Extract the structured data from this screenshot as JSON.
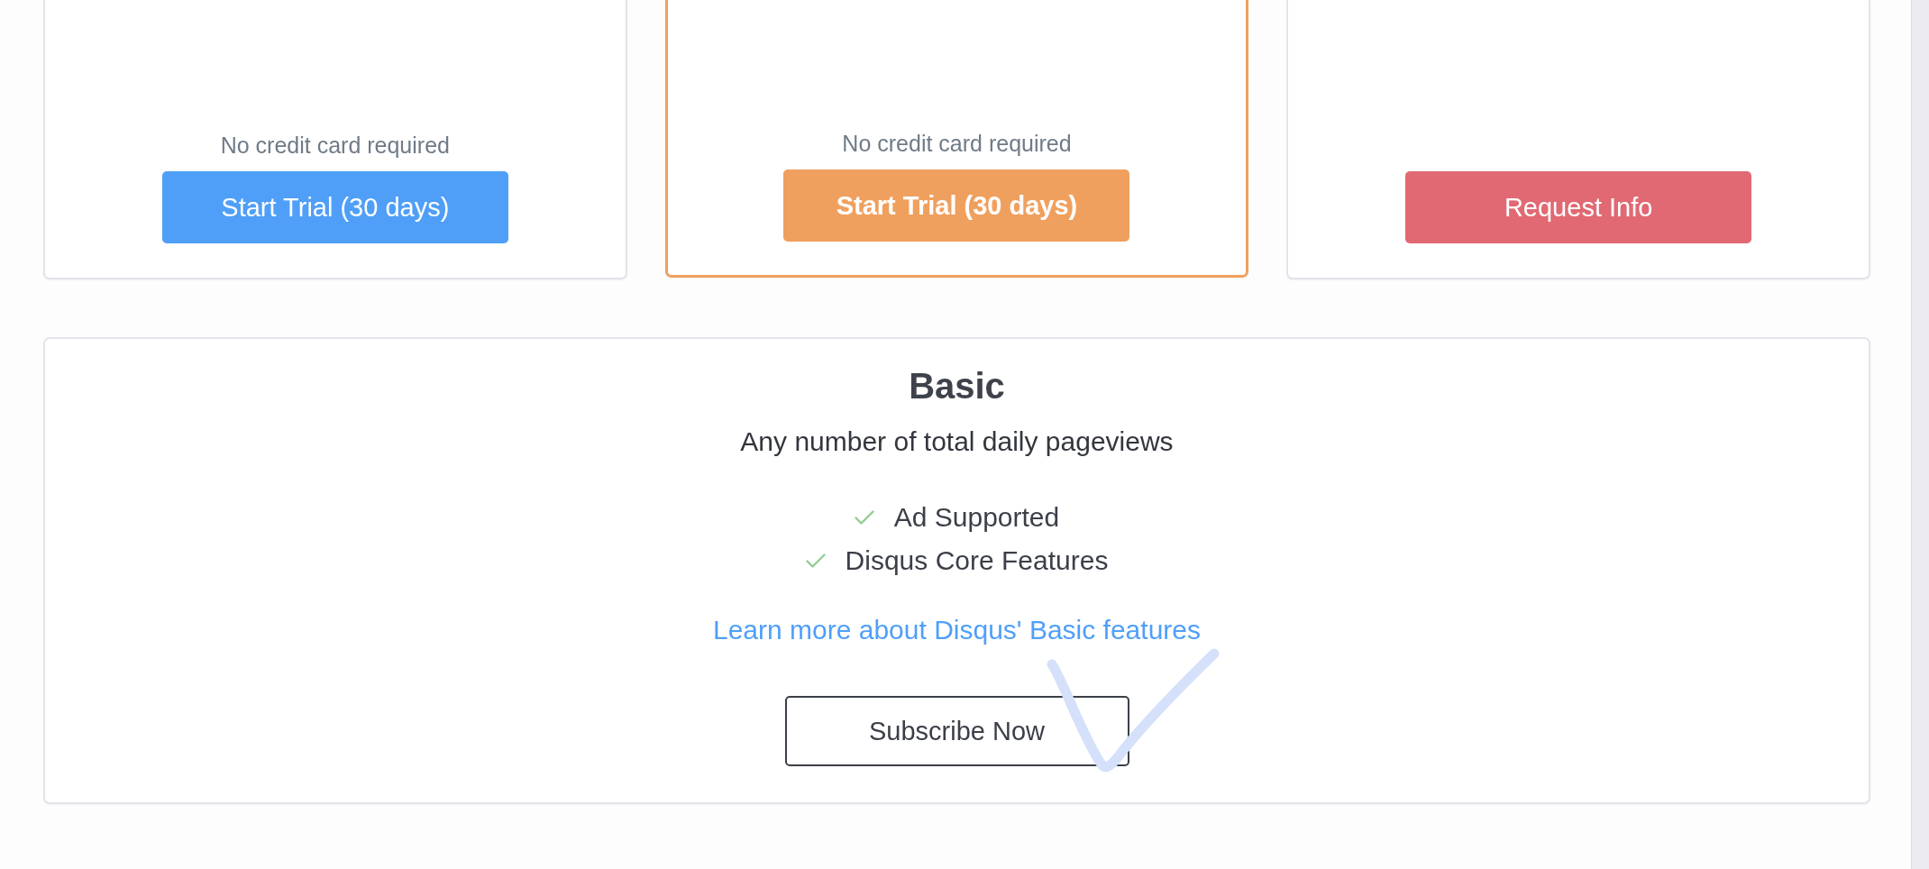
{
  "plans": [
    {
      "note": "No credit card required",
      "button": "Start Trial (30 days)",
      "color": "#4f9ff8",
      "featured": false
    },
    {
      "note": "No credit card required",
      "button": "Start Trial (30 days)",
      "color": "#f0a05e",
      "featured": true
    },
    {
      "button": "Request Info",
      "color": "#e16973",
      "featured": false
    }
  ],
  "basic_plan": {
    "title": "Basic",
    "subtitle": "Any number of total daily pageviews",
    "features": [
      "Ad Supported",
      "Disqus Core Features"
    ],
    "link": "Learn more about Disqus' Basic features",
    "button": "Subscribe Now"
  }
}
